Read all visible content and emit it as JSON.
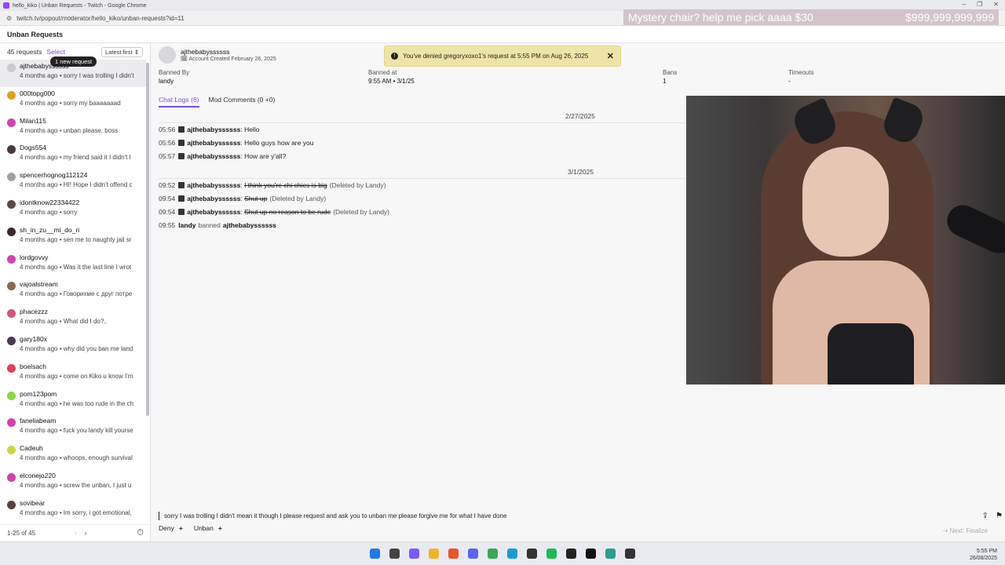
{
  "browser": {
    "title": "hello_kiko | Unban Requests - Twitch - Google Chrome",
    "url": "twitch.tv/popout/moderator/hello_kiko/unban-requests?id=11",
    "overlay_left": "Mystery chair? help me pick aaaa $30",
    "overlay_right": "$999,999,999,999"
  },
  "app": {
    "header": "Unban Requests"
  },
  "sidebar": {
    "count": "45 requests",
    "select": "Select",
    "sort": "Latest first",
    "new_badge": "1 new request",
    "items": [
      {
        "name": "ajthebabyssssss",
        "meta": "4 months ago • sorry I was trolling I didn't",
        "color": "#c9c9cf"
      },
      {
        "name": "000topg000",
        "meta": "4 months ago • sorry my baaaaaaad",
        "color": "#e0a020"
      },
      {
        "name": "Milan115",
        "meta": "4 months ago • unban please, boss",
        "color": "#d63fb0"
      },
      {
        "name": "Dogs554",
        "meta": "4 months ago • my friend said it I didn't I",
        "color": "#4a3a3a"
      },
      {
        "name": "spencerhognog112124",
        "meta": "4 months ago • HI! Hope I didn't offend c",
        "color": "#a0a0a8"
      },
      {
        "name": "idontknow22334422",
        "meta": "4 months ago • sorry",
        "color": "#5a4a40"
      },
      {
        "name": "sh_in_zu__mi_do_ri",
        "meta": "4 months ago • sen me to naughty jail sr",
        "color": "#3a2a2a"
      },
      {
        "name": "lordgovvy",
        "meta": "4 months ago • Was it the last line I wrot",
        "color": "#d63fb0"
      },
      {
        "name": "vajoatstream",
        "meta": "4 months ago • Говорихме с друг потре",
        "color": "#8a6a50"
      },
      {
        "name": "phacezzz",
        "meta": "4 months ago • What did I do?..",
        "color": "#d6557a"
      },
      {
        "name": "gary180x",
        "meta": "4 months ago • why did you ban me land",
        "color": "#4a3a50"
      },
      {
        "name": "boelsach",
        "meta": "4 months ago • come on Kiko u know I'm",
        "color": "#e0405a"
      },
      {
        "name": "pom123pom",
        "meta": "4 months ago • he was too rude in the ch",
        "color": "#8ad63f"
      },
      {
        "name": "faneliabeam",
        "meta": "4 months ago • fuck you landy kill yourse",
        "color": "#d63fb0"
      },
      {
        "name": "Cadeuh",
        "meta": "4 months ago • whoops, enough survival",
        "color": "#c8d63f"
      },
      {
        "name": "elconejo220",
        "meta": "4 months ago • screw the unban, I just u",
        "color": "#d63fb0"
      },
      {
        "name": "sovibear",
        "meta": "4 months ago • Im sorry, i got emotional,",
        "color": "#5a4040"
      }
    ],
    "pagination": "1-25 of 45"
  },
  "detail": {
    "username": "ajthebabyssssss",
    "created": "Account Created February 26, 2025",
    "banned_by_label": "Banned By",
    "banned_by": "landy",
    "banned_at_label": "Banned at",
    "banned_at": "9:55 AM • 3/1/25",
    "bans_label": "Bans",
    "bans": "1",
    "timeouts_label": "Timeouts",
    "timeouts": "-",
    "tab_chat": "Chat Logs (6)",
    "tab_mod": "Mod Comments (0 +0)"
  },
  "toast": {
    "text": "You've denied gregoryxoxo1's request at 5:55 PM on Aug 26, 2025",
    "close": "✕"
  },
  "log": {
    "date1": "2/27/2025",
    "date2": "3/1/2025",
    "lines1": [
      {
        "time": "05:56",
        "user": "ajthebabyssssss",
        "msg": "Hello"
      },
      {
        "time": "05:56",
        "user": "ajthebabyssssss",
        "msg": "Hello guys how are you"
      },
      {
        "time": "05:57",
        "user": "ajthebabyssssss",
        "msg": "How are y'all?"
      }
    ],
    "lines2": [
      {
        "time": "09:52",
        "user": "ajthebabyssssss",
        "msg": "I think you're chi chies is big",
        "note": "(Deleted by Landy)"
      },
      {
        "time": "09:54",
        "user": "ajthebabyssssss",
        "msg": "Shut up",
        "note": "(Deleted by Landy)"
      },
      {
        "time": "09:54",
        "user": "ajthebabyssssss",
        "msg": "Shut up no reason to be rude",
        "note": "(Deleted by Landy)"
      }
    ],
    "ban_time": "09:55",
    "ban_mod": "landy",
    "ban_word": "banned",
    "ban_user": "ajthebabyssssss"
  },
  "compose": {
    "text": "sorry I was trolling I didn't mean it though I please request and ask you to unban me please forgive me for what I have done",
    "deny": "Deny",
    "unban": "Unban",
    "next": "Next: Finalize"
  },
  "clock": {
    "time": "5:55 PM",
    "date": "26/08/2025"
  }
}
